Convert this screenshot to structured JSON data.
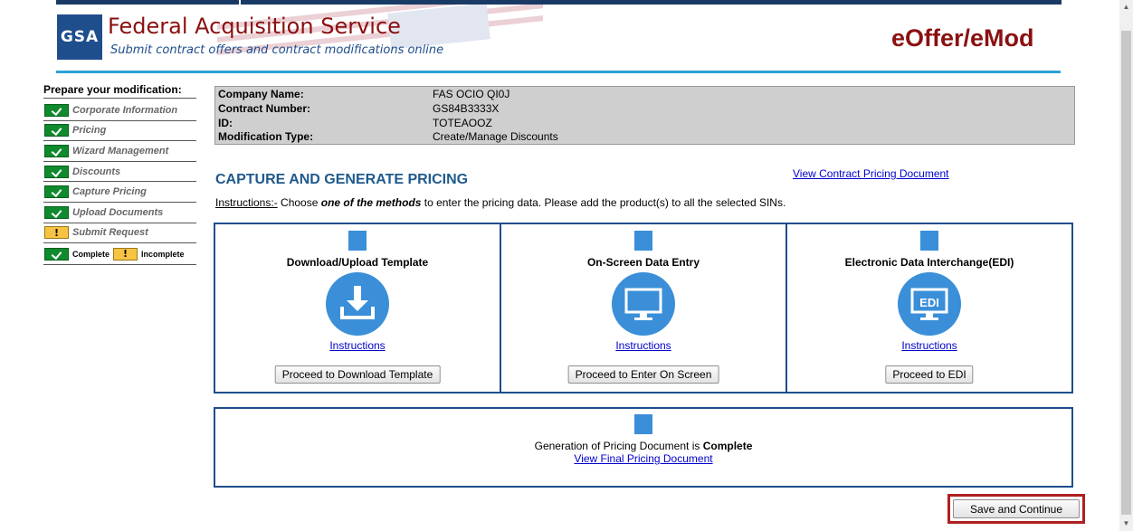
{
  "header": {
    "logo_text": "GSA",
    "title": "Federal Acquisition Service",
    "subtitle": "Submit contract offers and contract modifications online",
    "app_title": "eOffer/eMod"
  },
  "sidebar": {
    "title": "Prepare your modification:",
    "steps": [
      {
        "label": "Corporate Information",
        "status": "complete"
      },
      {
        "label": "Pricing",
        "status": "complete"
      },
      {
        "label": "Wizard Management",
        "status": "complete"
      },
      {
        "label": "Discounts",
        "status": "complete"
      },
      {
        "label": "Capture Pricing",
        "status": "complete"
      },
      {
        "label": "Upload Documents",
        "status": "complete"
      },
      {
        "label": "Submit Request",
        "status": "incomplete"
      }
    ],
    "legend": {
      "complete": "Complete",
      "incomplete": "Incomplete"
    }
  },
  "contract_info": {
    "company_name_label": "Company Name:",
    "company_name": "FAS OCIO QI0J",
    "contract_number_label": "Contract Number:",
    "contract_number": "GS84B3333X",
    "id_label": "ID:",
    "id": "TOTEAOOZ",
    "modification_type_label": "Modification Type:",
    "modification_type": "Create/Manage Discounts"
  },
  "main": {
    "section_title": "CAPTURE AND GENERATE PRICING",
    "view_contract_link": "View Contract Pricing Document",
    "instructions_label": "Instructions:-",
    "instructions_pre": " Choose ",
    "instructions_em": "one of the methods",
    "instructions_post": " to enter the pricing data. Please add the product(s) to all the selected SINs.",
    "methods": [
      {
        "title": "Download/Upload Template",
        "link": "Instructions ",
        "button": "Proceed to Download Template",
        "icon": "download-icon"
      },
      {
        "title": "On-Screen Data Entry",
        "link": "Instructions ",
        "button": "Proceed to Enter On Screen",
        "icon": "monitor-icon"
      },
      {
        "title": "Electronic Data Interchange(EDI)",
        "link": "Instructions",
        "button": "Proceed to EDI",
        "icon": "edi-icon",
        "icon_text": "EDI"
      }
    ],
    "generation_text": "Generation of Pricing Document is ",
    "generation_status": "Complete",
    "view_final_link": "View Final Pricing Document",
    "save_button": "Save and Continue"
  },
  "colors": {
    "brand_red": "#8b1010",
    "brand_blue": "#1f4e8c",
    "accent_blue": "#3a8fd8",
    "complete_green": "#0f8a2d",
    "incomplete_yellow": "#f6c343"
  }
}
